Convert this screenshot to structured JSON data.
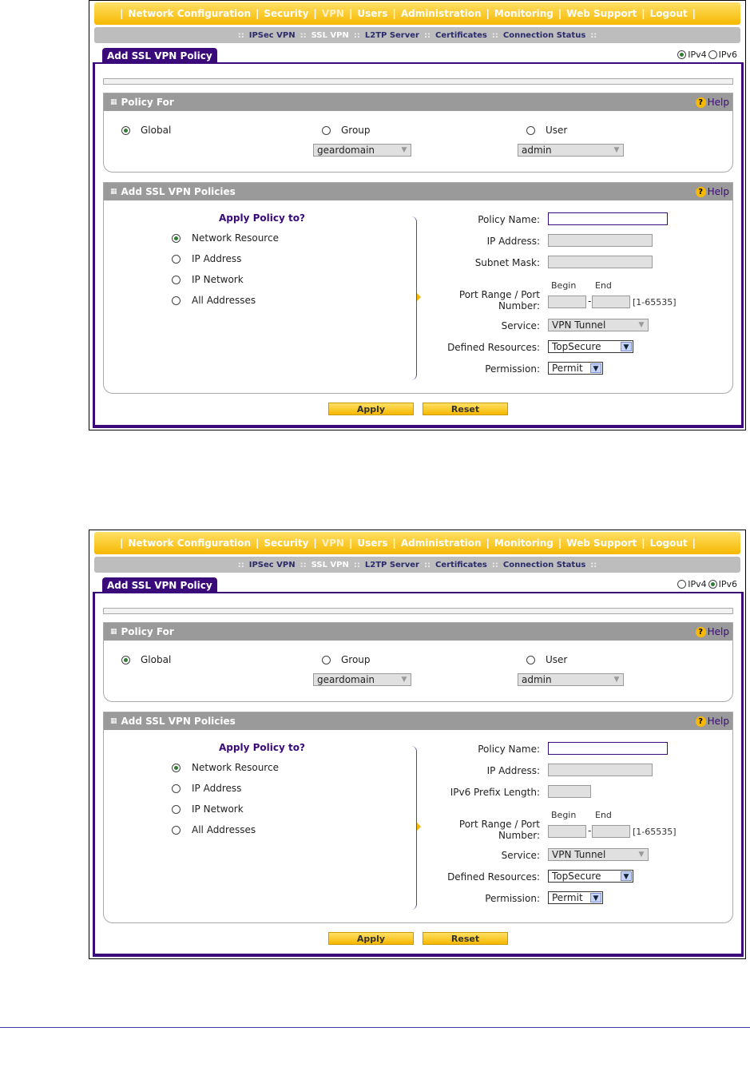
{
  "nav": {
    "items": [
      "Network Configuration",
      "Security",
      "VPN",
      "Users",
      "Administration",
      "Monitoring",
      "Web Support",
      "Logout"
    ],
    "active": "VPN"
  },
  "subnav": {
    "items": [
      "IPSec VPN",
      "SSL VPN",
      "L2TP Server",
      "Certificates",
      "Connection Status"
    ],
    "active": "SSL VPN"
  },
  "tab_title": "Add SSL VPN Policy",
  "ip_options": [
    "IPv4",
    "IPv6"
  ],
  "policy_for": {
    "title": "Policy For",
    "help": "Help",
    "options": {
      "global": "Global",
      "group": "Group",
      "user": "User"
    },
    "group_value": "geardomain",
    "user_value": "admin"
  },
  "policies": {
    "title": "Add SSL VPN Policies",
    "help": "Help",
    "apply_title": "Apply Policy to?",
    "targets": [
      "Network Resource",
      "IP Address",
      "IP Network",
      "All Addresses"
    ],
    "labels": {
      "policy_name": "Policy Name:",
      "ip_address": "IP Address:",
      "subnet_mask": "Subnet Mask:",
      "ipv6_prefix": "IPv6 Prefix Length:",
      "port_range_1": "Port Range / Port",
      "port_range_2": "Number:",
      "begin": "Begin",
      "end": "End",
      "dash": "-",
      "range_hint": "[1-65535]",
      "service": "Service:",
      "defined_resources": "Defined Resources:",
      "permission": "Permission:"
    },
    "service_value": "VPN Tunnel",
    "resources_value": "TopSecure",
    "permission_value": "Permit"
  },
  "buttons": {
    "apply": "Apply",
    "reset": "Reset"
  },
  "screens": [
    {
      "id": "ipv4",
      "selected_ip": "IPv4",
      "third_field": "subnet_mask"
    },
    {
      "id": "ipv6",
      "selected_ip": "IPv6",
      "third_field": "ipv6_prefix"
    }
  ],
  "colors": {
    "nav": "#f6b800",
    "accent": "#3a0a7a",
    "panel_head": "#9a9a9a"
  }
}
